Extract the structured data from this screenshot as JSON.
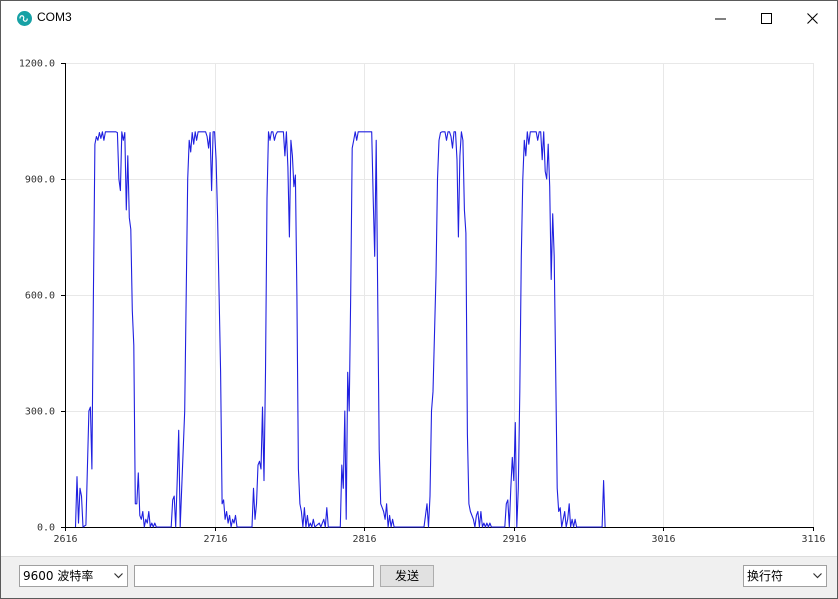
{
  "window": {
    "title": "COM3",
    "icon": "arduino-logo-icon",
    "controls": [
      "minimize-icon",
      "maximize-icon",
      "close-icon"
    ]
  },
  "chart_data": {
    "type": "line",
    "title": "",
    "xlabel": "",
    "ylabel": "",
    "xlim": [
      2616,
      3116
    ],
    "ylim": [
      0,
      1200
    ],
    "x_ticks": [
      "2616",
      "2716",
      "2816",
      "2916",
      "3016",
      "3116"
    ],
    "y_ticks": [
      "0.0",
      "300.0",
      "600.0",
      "900.0",
      "1200.0"
    ],
    "grid": true,
    "series": [
      {
        "color": "#2020e0",
        "points": [
          [
            2623,
            0
          ],
          [
            2624,
            130
          ],
          [
            2625,
            10
          ],
          [
            2626,
            100
          ],
          [
            2627,
            80
          ],
          [
            2628,
            0
          ],
          [
            2630,
            5
          ],
          [
            2632,
            300
          ],
          [
            2633,
            310
          ],
          [
            2634,
            150
          ],
          [
            2635,
            600
          ],
          [
            2636,
            990
          ],
          [
            2637,
            1010
          ],
          [
            2638,
            1000
          ],
          [
            2639,
            1020
          ],
          [
            2640,
            1005
          ],
          [
            2641,
            1022
          ],
          [
            2642,
            1000
          ],
          [
            2643,
            1022
          ],
          [
            2650,
            1022
          ],
          [
            2651,
            1020
          ],
          [
            2652,
            900
          ],
          [
            2653,
            870
          ],
          [
            2654,
            1022
          ],
          [
            2655,
            1000
          ],
          [
            2656,
            1020
          ],
          [
            2657,
            820
          ],
          [
            2658,
            960
          ],
          [
            2659,
            800
          ],
          [
            2660,
            770
          ],
          [
            2661,
            560
          ],
          [
            2662,
            470
          ],
          [
            2663,
            60
          ],
          [
            2664,
            60
          ],
          [
            2665,
            140
          ],
          [
            2666,
            30
          ],
          [
            2667,
            20
          ],
          [
            2668,
            40
          ],
          [
            2669,
            0
          ],
          [
            2670,
            20
          ],
          [
            2671,
            10
          ],
          [
            2672,
            40
          ],
          [
            2673,
            0
          ],
          [
            2674,
            10
          ],
          [
            2675,
            0
          ],
          [
            2676,
            10
          ],
          [
            2677,
            0
          ],
          [
            2687,
            0
          ],
          [
            2688,
            70
          ],
          [
            2689,
            80
          ],
          [
            2690,
            0
          ],
          [
            2691,
            120
          ],
          [
            2692,
            250
          ],
          [
            2693,
            0
          ],
          [
            2694,
            100
          ],
          [
            2695,
            200
          ],
          [
            2696,
            300
          ],
          [
            2697,
            600
          ],
          [
            2698,
            900
          ],
          [
            2699,
            1000
          ],
          [
            2700,
            970
          ],
          [
            2701,
            1020
          ],
          [
            2702,
            990
          ],
          [
            2703,
            1022
          ],
          [
            2704,
            1000
          ],
          [
            2705,
            1022
          ],
          [
            2710,
            1022
          ],
          [
            2711,
            1010
          ],
          [
            2712,
            980
          ],
          [
            2713,
            1020
          ],
          [
            2714,
            870
          ],
          [
            2715,
            1022
          ],
          [
            2716,
            1022
          ],
          [
            2717,
            950
          ],
          [
            2718,
            800
          ],
          [
            2719,
            600
          ],
          [
            2720,
            400
          ],
          [
            2721,
            60
          ],
          [
            2722,
            70
          ],
          [
            2723,
            20
          ],
          [
            2724,
            40
          ],
          [
            2725,
            10
          ],
          [
            2726,
            30
          ],
          [
            2727,
            0
          ],
          [
            2728,
            20
          ],
          [
            2729,
            10
          ],
          [
            2730,
            30
          ],
          [
            2731,
            0
          ],
          [
            2741,
            0
          ],
          [
            2742,
            100
          ],
          [
            2743,
            20
          ],
          [
            2744,
            60
          ],
          [
            2745,
            160
          ],
          [
            2746,
            170
          ],
          [
            2747,
            150
          ],
          [
            2748,
            310
          ],
          [
            2749,
            120
          ],
          [
            2750,
            400
          ],
          [
            2751,
            850
          ],
          [
            2752,
            1022
          ],
          [
            2753,
            1000
          ],
          [
            2754,
            1022
          ],
          [
            2755,
            1022
          ],
          [
            2756,
            1000
          ],
          [
            2757,
            1015
          ],
          [
            2758,
            1022
          ],
          [
            2762,
            1022
          ],
          [
            2763,
            960
          ],
          [
            2764,
            1022
          ],
          [
            2765,
            930
          ],
          [
            2766,
            750
          ],
          [
            2767,
            1000
          ],
          [
            2768,
            960
          ],
          [
            2769,
            880
          ],
          [
            2770,
            910
          ],
          [
            2771,
            600
          ],
          [
            2772,
            150
          ],
          [
            2773,
            60
          ],
          [
            2774,
            40
          ],
          [
            2775,
            0
          ],
          [
            2776,
            50
          ],
          [
            2777,
            0
          ],
          [
            2778,
            30
          ],
          [
            2779,
            0
          ],
          [
            2780,
            10
          ],
          [
            2781,
            0
          ],
          [
            2782,
            20
          ],
          [
            2783,
            0
          ],
          [
            2786,
            10
          ],
          [
            2787,
            0
          ],
          [
            2789,
            20
          ],
          [
            2790,
            0
          ],
          [
            2791,
            50
          ],
          [
            2792,
            0
          ],
          [
            2800,
            0
          ],
          [
            2801,
            160
          ],
          [
            2802,
            100
          ],
          [
            2803,
            300
          ],
          [
            2804,
            20
          ],
          [
            2805,
            400
          ],
          [
            2806,
            300
          ],
          [
            2807,
            600
          ],
          [
            2808,
            980
          ],
          [
            2809,
            1000
          ],
          [
            2810,
            1022
          ],
          [
            2811,
            1000
          ],
          [
            2812,
            1022
          ],
          [
            2820,
            1022
          ],
          [
            2821,
            1022
          ],
          [
            2822,
            850
          ],
          [
            2823,
            700
          ],
          [
            2824,
            1000
          ],
          [
            2825,
            600
          ],
          [
            2826,
            200
          ],
          [
            2827,
            60
          ],
          [
            2828,
            50
          ],
          [
            2829,
            40
          ],
          [
            2830,
            20
          ],
          [
            2831,
            60
          ],
          [
            2832,
            0
          ],
          [
            2833,
            30
          ],
          [
            2834,
            0
          ],
          [
            2835,
            20
          ],
          [
            2836,
            0
          ],
          [
            2856,
            0
          ],
          [
            2857,
            30
          ],
          [
            2858,
            60
          ],
          [
            2859,
            0
          ],
          [
            2860,
            80
          ],
          [
            2861,
            300
          ],
          [
            2862,
            350
          ],
          [
            2863,
            500
          ],
          [
            2864,
            650
          ],
          [
            2865,
            900
          ],
          [
            2866,
            1000
          ],
          [
            2867,
            1020
          ],
          [
            2868,
            1022
          ],
          [
            2870,
            1022
          ],
          [
            2871,
            1000
          ],
          [
            2872,
            1022
          ],
          [
            2873,
            1022
          ],
          [
            2874,
            1010
          ],
          [
            2875,
            980
          ],
          [
            2876,
            1022
          ],
          [
            2877,
            1022
          ],
          [
            2878,
            950
          ],
          [
            2879,
            750
          ],
          [
            2880,
            960
          ],
          [
            2881,
            1022
          ],
          [
            2882,
            1000
          ],
          [
            2883,
            820
          ],
          [
            2884,
            760
          ],
          [
            2885,
            240
          ],
          [
            2886,
            60
          ],
          [
            2887,
            40
          ],
          [
            2888,
            30
          ],
          [
            2889,
            20
          ],
          [
            2890,
            0
          ],
          [
            2891,
            30
          ],
          [
            2892,
            40
          ],
          [
            2893,
            0
          ],
          [
            2894,
            40
          ],
          [
            2895,
            0
          ],
          [
            2896,
            10
          ],
          [
            2897,
            0
          ],
          [
            2898,
            10
          ],
          [
            2899,
            0
          ],
          [
            2900,
            10
          ],
          [
            2901,
            0
          ],
          [
            2910,
            0
          ],
          [
            2911,
            60
          ],
          [
            2912,
            70
          ],
          [
            2913,
            0
          ],
          [
            2914,
            100
          ],
          [
            2915,
            180
          ],
          [
            2916,
            120
          ],
          [
            2917,
            270
          ],
          [
            2918,
            0
          ],
          [
            2919,
            100
          ],
          [
            2920,
            350
          ],
          [
            2921,
            700
          ],
          [
            2922,
            900
          ],
          [
            2923,
            1000
          ],
          [
            2924,
            960
          ],
          [
            2925,
            1022
          ],
          [
            2926,
            990
          ],
          [
            2927,
            1022
          ],
          [
            2930,
            1022
          ],
          [
            2931,
            1022
          ],
          [
            2932,
            1000
          ],
          [
            2933,
            1022
          ],
          [
            2934,
            1022
          ],
          [
            2935,
            950
          ],
          [
            2936,
            1022
          ],
          [
            2937,
            920
          ],
          [
            2938,
            900
          ],
          [
            2939,
            990
          ],
          [
            2940,
            880
          ],
          [
            2941,
            640
          ],
          [
            2942,
            810
          ],
          [
            2943,
            700
          ],
          [
            2944,
            400
          ],
          [
            2945,
            100
          ],
          [
            2946,
            40
          ],
          [
            2947,
            50
          ],
          [
            2948,
            0
          ],
          [
            2949,
            20
          ],
          [
            2950,
            40
          ],
          [
            2951,
            0
          ],
          [
            2952,
            20
          ],
          [
            2953,
            60
          ],
          [
            2954,
            0
          ],
          [
            2955,
            20
          ],
          [
            2956,
            0
          ],
          [
            2957,
            20
          ],
          [
            2958,
            0
          ],
          [
            2975,
            0
          ],
          [
            2976,
            120
          ],
          [
            2977,
            0
          ]
        ]
      }
    ]
  },
  "controls": {
    "baud_rate": "9600  波特率",
    "send_input_value": "",
    "send_label": "发送",
    "line_ending": "换行符"
  }
}
